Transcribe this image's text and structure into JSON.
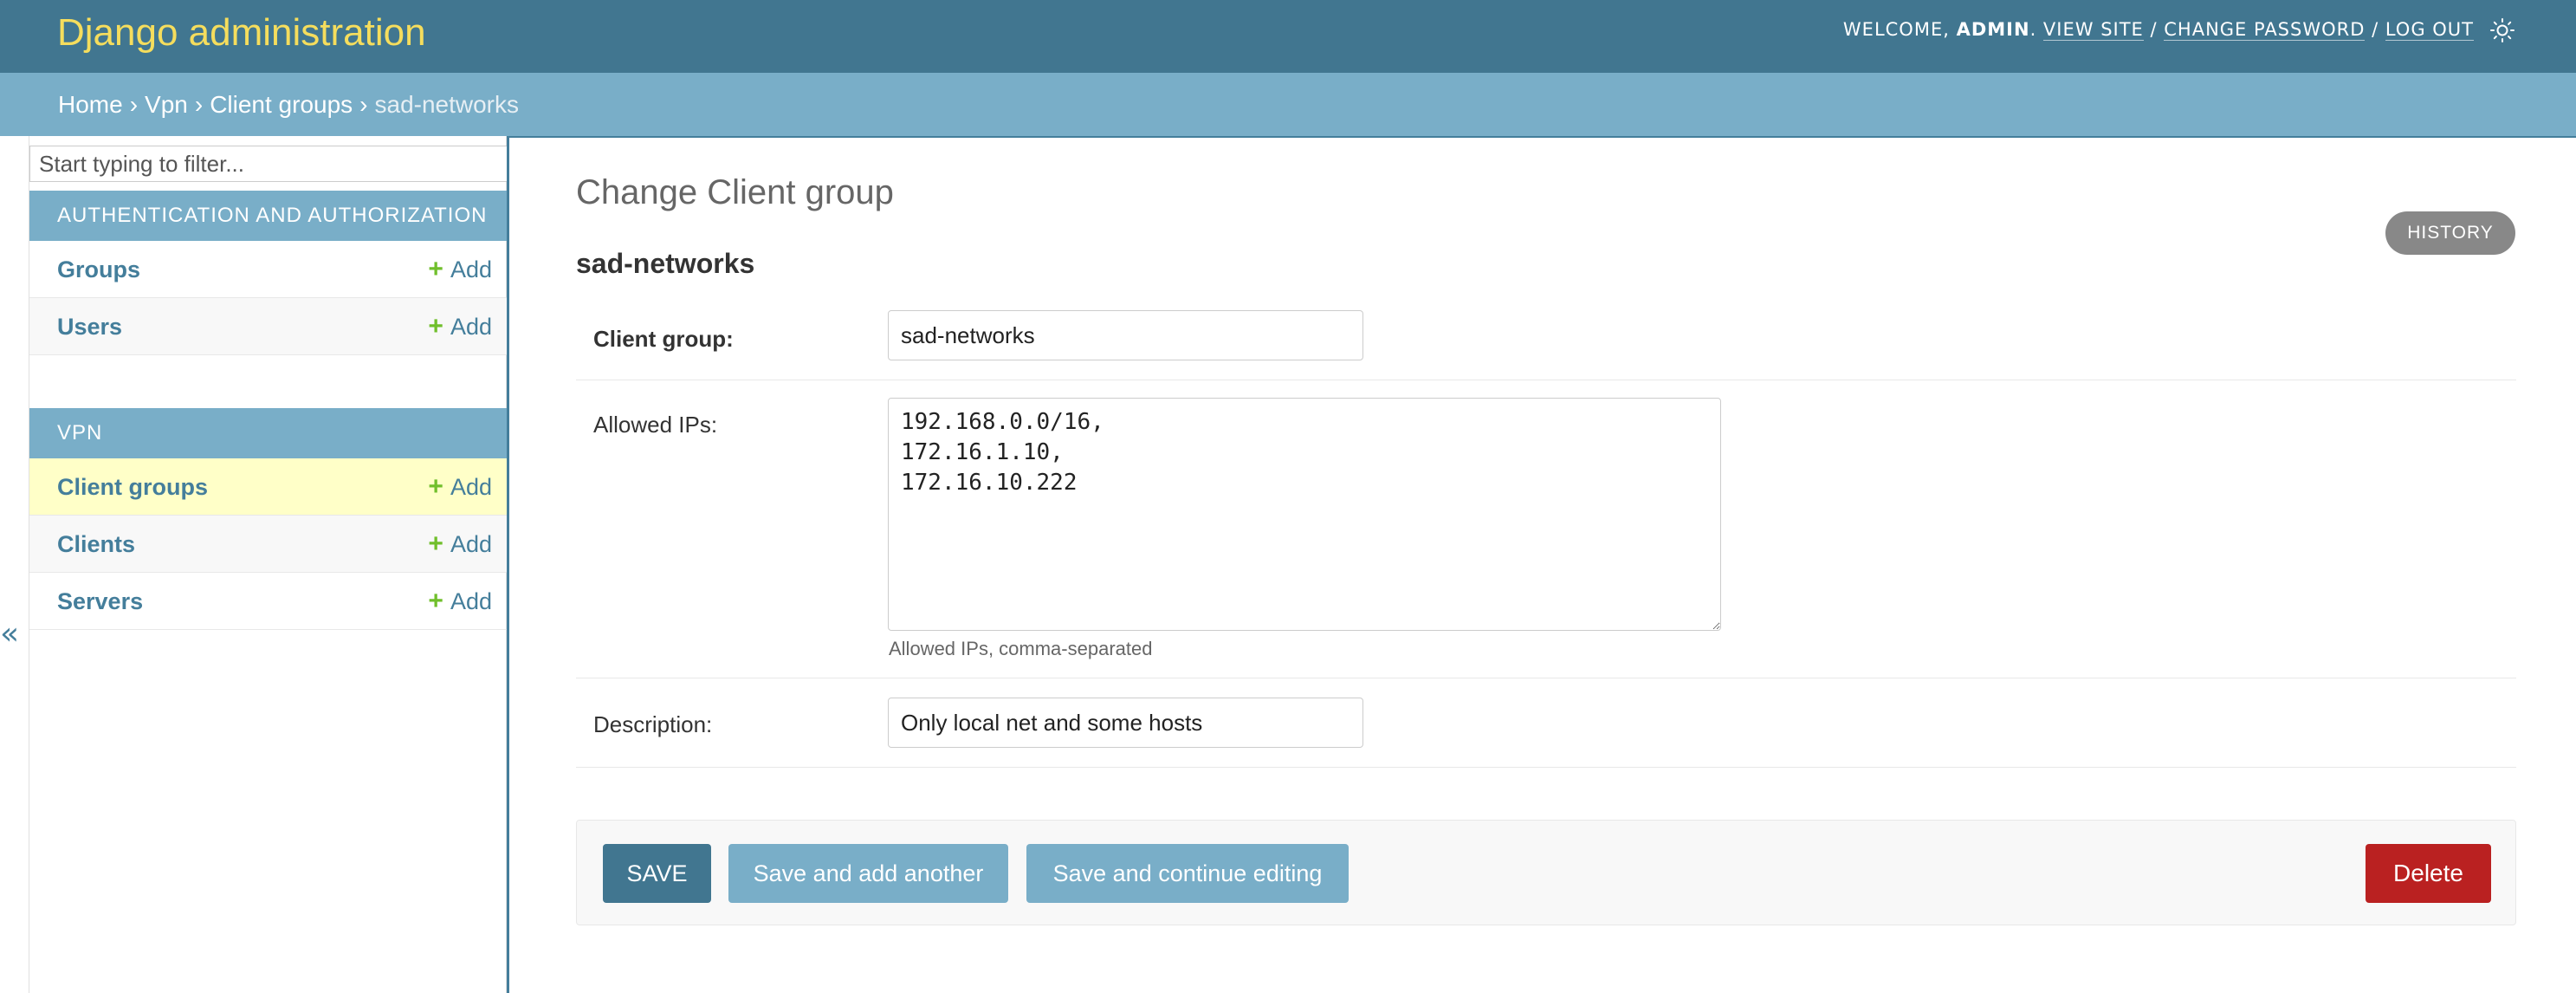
{
  "header": {
    "branding": "Django administration",
    "welcome_prefix": "WELCOME, ",
    "username": "ADMIN",
    "welcome_suffix": ". ",
    "view_site": "VIEW SITE",
    "sep1": " / ",
    "change_password": "CHANGE PASSWORD",
    "sep2": " / ",
    "log_out": "LOG OUT",
    "theme_icon": "sun-icon"
  },
  "breadcrumbs": {
    "items": [
      "Home",
      "Vpn",
      "Client groups"
    ],
    "separator": "›",
    "current": "sad-networks"
  },
  "sidebar": {
    "filter_placeholder": "Start typing to filter...",
    "modules": [
      {
        "caption": "AUTHENTICATION AND AUTHORIZATION",
        "models": [
          {
            "name": "Groups",
            "add": "Add"
          },
          {
            "name": "Users",
            "add": "Add"
          }
        ]
      },
      {
        "caption": "VPN",
        "models": [
          {
            "name": "Client groups",
            "add": "Add"
          },
          {
            "name": "Clients",
            "add": "Add"
          },
          {
            "name": "Servers",
            "add": "Add"
          }
        ]
      }
    ],
    "collapse_toggle": "«",
    "add_icon": "plus-icon"
  },
  "main": {
    "title": "Change Client group",
    "history": "HISTORY",
    "object_name": "sad-networks",
    "fields": {
      "client_group": {
        "label": "Client group:",
        "value": "sad-networks"
      },
      "allowed_ips": {
        "label": "Allowed IPs:",
        "value": "192.168.0.0/16,\n172.16.1.10,\n172.16.10.222",
        "help": "Allowed IPs, comma-separated"
      },
      "description": {
        "label": "Description:",
        "value": "Only local net and some hosts"
      }
    },
    "buttons": {
      "save": "SAVE",
      "save_add_another": "Save and add another",
      "save_continue": "Save and continue editing",
      "delete": "Delete"
    }
  },
  "colors": {
    "header_bg": "#417690",
    "branding": "#f5dd5d",
    "breadcrumbs_bg": "#79aec8",
    "link": "#447e9b",
    "add_plus": "#70bf2b",
    "current_row": "#ffffc8",
    "delete": "#ba2121"
  }
}
